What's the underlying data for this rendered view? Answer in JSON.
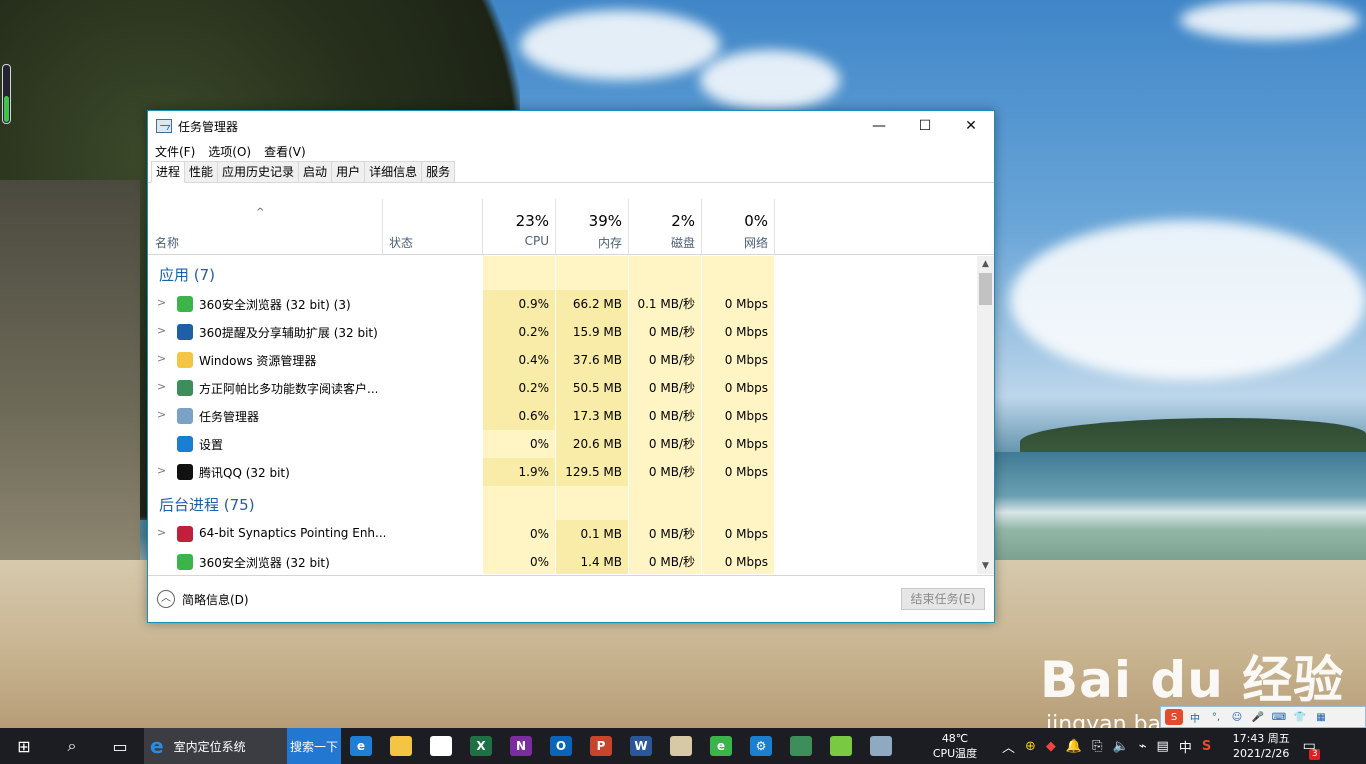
{
  "window": {
    "title": "任务管理器",
    "controls": {
      "minimize": "—",
      "maximize": "☐",
      "close": "✕"
    }
  },
  "menu": [
    "文件(F)",
    "选项(O)",
    "查看(V)"
  ],
  "tabs": [
    "进程",
    "性能",
    "应用历史记录",
    "启动",
    "用户",
    "详细信息",
    "服务"
  ],
  "columns": {
    "name": "名称",
    "status": "状态",
    "cpu": {
      "pct": "23%",
      "label": "CPU"
    },
    "memory": {
      "pct": "39%",
      "label": "内存"
    },
    "disk": {
      "pct": "2%",
      "label": "磁盘"
    },
    "network": {
      "pct": "0%",
      "label": "网络"
    }
  },
  "groups": [
    {
      "title": "应用 (7)",
      "rows": [
        {
          "name": "360安全浏览器 (32 bit) (3)",
          "icon": "browser-360-icon",
          "icon_color": "#3bb54a",
          "expandable": true,
          "cpu": "0.9%",
          "mem": "66.2 MB",
          "disk": "0.1 MB/秒",
          "net": "0 Mbps"
        },
        {
          "name": "360提醒及分享辅助扩展 (32 bit)",
          "icon": "share-extension-icon",
          "icon_color": "#1f5fa8",
          "expandable": true,
          "cpu": "0.2%",
          "mem": "15.9 MB",
          "disk": "0 MB/秒",
          "net": "0 Mbps"
        },
        {
          "name": "Windows 资源管理器",
          "icon": "folder-icon",
          "icon_color": "#f4c542",
          "expandable": true,
          "cpu": "0.4%",
          "mem": "37.6 MB",
          "disk": "0 MB/秒",
          "net": "0 Mbps"
        },
        {
          "name": "方正阿帕比多功能数字阅读客户...",
          "icon": "reader-icon",
          "icon_color": "#3e8e5c",
          "expandable": true,
          "cpu": "0.2%",
          "mem": "50.5 MB",
          "disk": "0 MB/秒",
          "net": "0 Mbps"
        },
        {
          "name": "任务管理器",
          "icon": "task-manager-icon",
          "icon_color": "#7aa2c4",
          "expandable": true,
          "cpu": "0.6%",
          "mem": "17.3 MB",
          "disk": "0 MB/秒",
          "net": "0 Mbps"
        },
        {
          "name": "设置",
          "icon": "settings-gear-icon",
          "icon_color": "#1a7fd0",
          "expandable": false,
          "cpu": "0%",
          "mem": "20.6 MB",
          "disk": "0 MB/秒",
          "net": "0 Mbps"
        },
        {
          "name": "腾讯QQ (32 bit)",
          "icon": "qq-penguin-icon",
          "icon_color": "#111111",
          "expandable": true,
          "cpu": "1.9%",
          "mem": "129.5 MB",
          "disk": "0 MB/秒",
          "net": "0 Mbps"
        }
      ]
    },
    {
      "title": "后台进程 (75)",
      "rows": [
        {
          "name": "64-bit Synaptics Pointing Enh...",
          "icon": "synaptics-icon",
          "icon_color": "#c0203a",
          "expandable": true,
          "cpu": "0%",
          "mem": "0.1 MB",
          "disk": "0 MB/秒",
          "net": "0 Mbps"
        },
        {
          "name": "360安全浏览器 (32 bit)",
          "icon": "browser-360-icon",
          "icon_color": "#3bb54a",
          "expandable": false,
          "cpu": "0%",
          "mem": "1.4 MB",
          "disk": "0 MB/秒",
          "net": "0 Mbps"
        }
      ]
    }
  ],
  "footer": {
    "fewer_details": "简略信息(D)",
    "end_task": "结束任务(E)"
  },
  "taskbar": {
    "ie_title": "室内定位系统",
    "search_button": "搜索一下",
    "apps": [
      {
        "name": "edge-icon",
        "label": "e",
        "color": "#1f7fd6"
      },
      {
        "name": "file-explorer-icon",
        "label": "",
        "color": "#f4c542"
      },
      {
        "name": "store-icon",
        "label": "",
        "color": "#ffffff"
      },
      {
        "name": "excel-icon",
        "label": "X",
        "color": "#1e7145"
      },
      {
        "name": "onenote-icon",
        "label": "N",
        "color": "#7b2c9e"
      },
      {
        "name": "outlook-icon",
        "label": "O",
        "color": "#0a64b8"
      },
      {
        "name": "powerpoint-icon",
        "label": "P",
        "color": "#c8452c"
      },
      {
        "name": "word-icon",
        "label": "W",
        "color": "#2b579a"
      },
      {
        "name": "paint-icon",
        "label": "",
        "color": "#d8c9a6"
      },
      {
        "name": "browser-360-icon",
        "label": "e",
        "color": "#3bb54a"
      },
      {
        "name": "settings-icon",
        "label": "⚙",
        "color": "#1a7fd0"
      },
      {
        "name": "reader-icon",
        "label": "",
        "color": "#3e8e5c"
      },
      {
        "name": "android-icon",
        "label": "",
        "color": "#7ac943"
      },
      {
        "name": "task-manager-icon",
        "label": "",
        "color": "#8fa9c0"
      }
    ],
    "temperature": "48℃",
    "temperature_label": "CPU温度",
    "ime": "中",
    "clock_time": "17:43 周五",
    "clock_date": "2021/2/26",
    "notification_count": "3"
  },
  "watermark": {
    "logo": "Bai du 经验",
    "url": "jingyan.baidu.com"
  }
}
